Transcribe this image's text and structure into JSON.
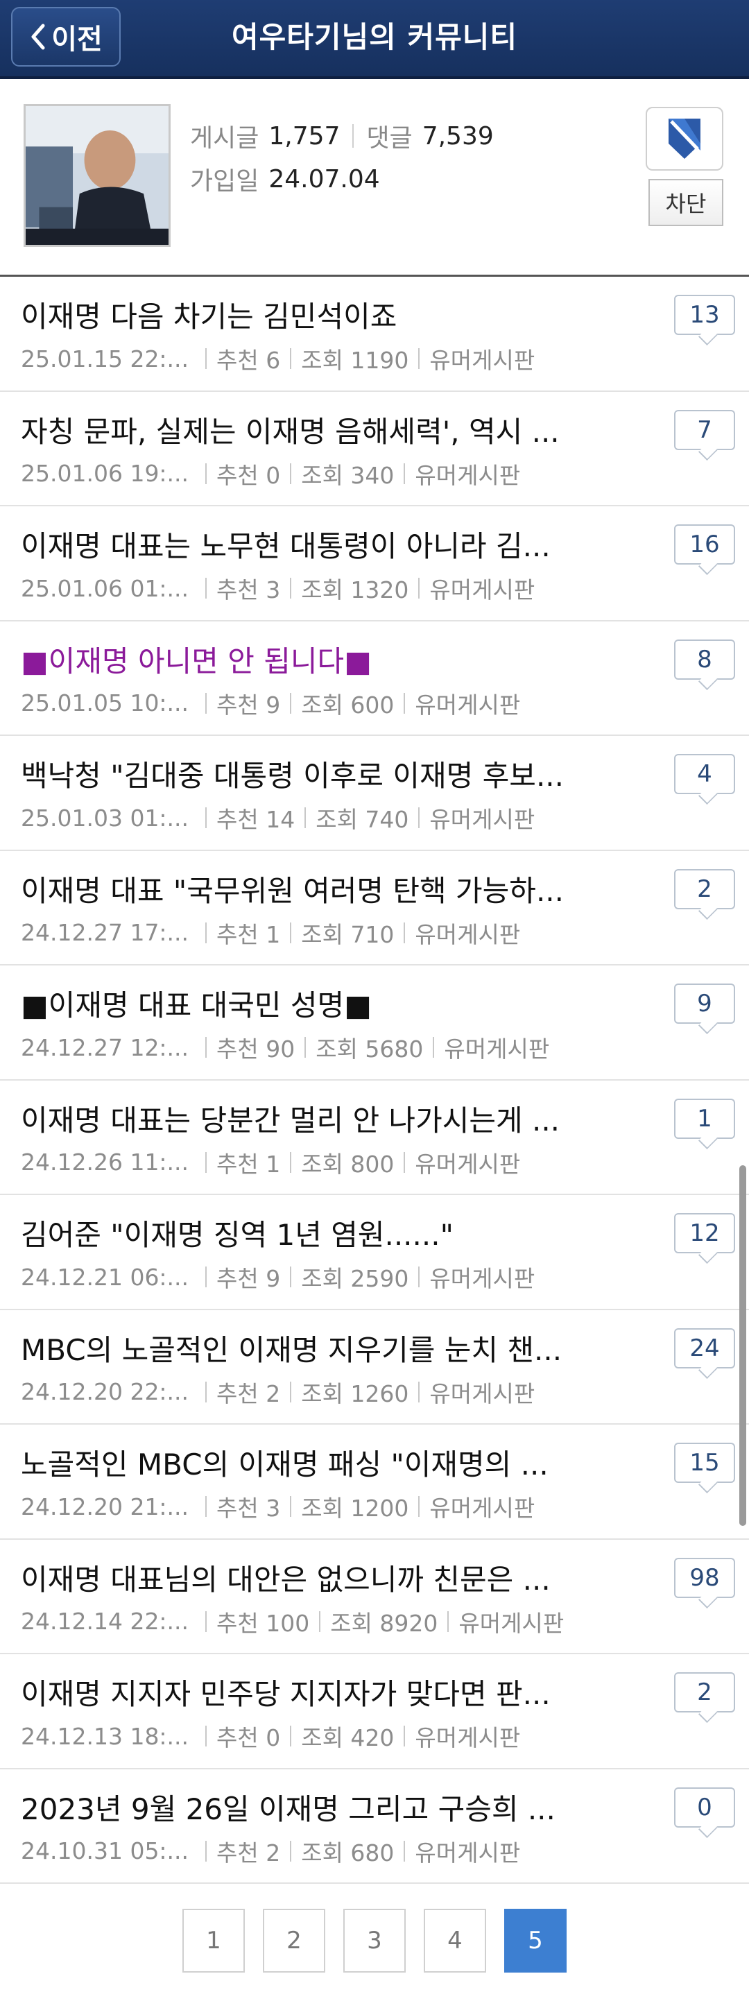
{
  "header": {
    "back_label": "이전",
    "title": "여우타기님의 커뮤니티"
  },
  "profile": {
    "posts_label": "게시글",
    "posts_value": "1,757",
    "comments_label": "댓글",
    "comments_value": "7,539",
    "joined_label": "가입일",
    "joined_value": "24.07.04",
    "block_label": "차단"
  },
  "posts": [
    {
      "title": "이재명 다음 차기는 김민석이죠",
      "date": "25.01.15 22:...",
      "likes": "추천 6",
      "views": "조회 1190",
      "board": "유머게시판",
      "comments": "13",
      "highlight": false
    },
    {
      "title": "자칭 문파, 실제는 이재명 음해세력', 역시 ...",
      "date": "25.01.06 19:...",
      "likes": "추천 0",
      "views": "조회 340",
      "board": "유머게시판",
      "comments": "7",
      "highlight": false
    },
    {
      "title": "이재명 대표는 노무현 대통령이 아니라 김...",
      "date": "25.01.06 01:...",
      "likes": "추천 3",
      "views": "조회 1320",
      "board": "유머게시판",
      "comments": "16",
      "highlight": false
    },
    {
      "title": "■이재명 아니면 안 됩니다■",
      "date": "25.01.05 10:...",
      "likes": "추천 9",
      "views": "조회 600",
      "board": "유머게시판",
      "comments": "8",
      "highlight": true
    },
    {
      "title": "백낙청 \"김대중 대통령 이후로 이재명 후보...",
      "date": "25.01.03 01:...",
      "likes": "추천 14",
      "views": "조회 740",
      "board": "유머게시판",
      "comments": "4",
      "highlight": false
    },
    {
      "title": "이재명 대표 \"국무위원 여러명 탄핵 가능하...",
      "date": "24.12.27 17:...",
      "likes": "추천 1",
      "views": "조회 710",
      "board": "유머게시판",
      "comments": "2",
      "highlight": false
    },
    {
      "title": "■이재명 대표 대국민 성명■",
      "date": "24.12.27 12:...",
      "likes": "추천 90",
      "views": "조회 5680",
      "board": "유머게시판",
      "comments": "9",
      "highlight": false
    },
    {
      "title": "이재명 대표는 당분간 멀리 안 나가시는게 ...",
      "date": "24.12.26 11:...",
      "likes": "추천 1",
      "views": "조회 800",
      "board": "유머게시판",
      "comments": "1",
      "highlight": false
    },
    {
      "title": "김어준 \"이재명 징역 1년 염원......\"",
      "date": "24.12.21 06:...",
      "likes": "추천 9",
      "views": "조회 2590",
      "board": "유머게시판",
      "comments": "12",
      "highlight": false
    },
    {
      "title": "MBC의 노골적인 이재명 지우기를 눈치 챈...",
      "date": "24.12.20 22:...",
      "likes": "추천 2",
      "views": "조회 1260",
      "board": "유머게시판",
      "comments": "24",
      "highlight": false
    },
    {
      "title": "노골적인 MBC의 이재명 패싱 \"이재명의 ...",
      "date": "24.12.20 21:...",
      "likes": "추천 3",
      "views": "조회 1200",
      "board": "유머게시판",
      "comments": "15",
      "highlight": false
    },
    {
      "title": "이재명 대표님의 대안은 없으니까 친문은 ...",
      "date": "24.12.14 22:...",
      "likes": "추천 100",
      "views": "조회 8920",
      "board": "유머게시판",
      "comments": "98",
      "highlight": false
    },
    {
      "title": "이재명 지지자 민주당 지지자가 맞다면 판...",
      "date": "24.12.13 18:...",
      "likes": "추천 0",
      "views": "조회 420",
      "board": "유머게시판",
      "comments": "2",
      "highlight": false
    },
    {
      "title": "2023년 9월 26일 이재명 그리고 구승희 ...",
      "date": "24.10.31 05:...",
      "likes": "추천 2",
      "views": "조회 680",
      "board": "유머게시판",
      "comments": "0",
      "highlight": false
    }
  ],
  "pagination": {
    "pages": [
      "1",
      "2",
      "3",
      "4",
      "5"
    ],
    "current": "5"
  },
  "colors": {
    "header_bg": "#1b3768",
    "highlight_title": "#8b1a9a",
    "active_page": "#3d7fd1"
  }
}
